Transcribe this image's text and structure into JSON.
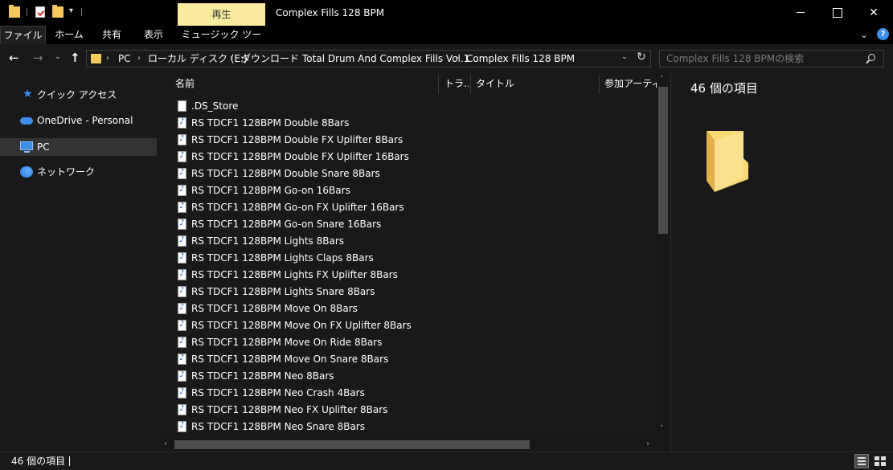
{
  "window": {
    "title": "Complex Fills 128 BPM",
    "contextual_tab": "再生",
    "controls": {
      "minimize": "",
      "maximize": "",
      "close": "✕"
    }
  },
  "quick_access": {
    "dropdown": "▾"
  },
  "ribbon": {
    "tabs": [
      "ファイル",
      "ホーム",
      "共有",
      "表示",
      "ミュージック ツール"
    ],
    "collapse_caret": "⌄",
    "help": "?"
  },
  "nav_buttons": {
    "back": "←",
    "forward": "→",
    "recent": "⌄",
    "up": "↑"
  },
  "address": {
    "crumbs": [
      "PC",
      "ローカル ディスク (E:)",
      "ダウンロード",
      "Total Drum And Complex Fills Vol.1",
      "Complex Fills 128 BPM"
    ],
    "separator": "›",
    "dropdown": "⌄",
    "refresh": "↻"
  },
  "search": {
    "placeholder": "Complex Fills 128 BPMの検索"
  },
  "sidebar": {
    "items": [
      {
        "label": "クイック アクセス",
        "icon": "star-icon",
        "selected": false
      },
      {
        "label": "OneDrive - Personal",
        "icon": "cloud-icon",
        "selected": false
      },
      {
        "label": "PC",
        "icon": "pc-icon",
        "selected": true
      },
      {
        "label": "ネットワーク",
        "icon": "network-icon",
        "selected": false
      }
    ]
  },
  "file_list": {
    "sort_indicator": "˄",
    "columns": [
      "名前",
      "トラ...",
      "タイトル",
      "参加アーティスト"
    ],
    "files": [
      {
        "name": ".DS_Store",
        "icon": "blank-file-icon"
      },
      {
        "name": "RS TDCF1 128BPM Double 8Bars",
        "icon": "audio-file-icon"
      },
      {
        "name": "RS TDCF1 128BPM Double FX Uplifter 8Bars",
        "icon": "audio-file-icon"
      },
      {
        "name": "RS TDCF1 128BPM Double FX Uplifter 16Bars",
        "icon": "audio-file-icon"
      },
      {
        "name": "RS TDCF1 128BPM Double Snare 8Bars",
        "icon": "audio-file-icon"
      },
      {
        "name": "RS TDCF1 128BPM Go-on 16Bars",
        "icon": "audio-file-icon"
      },
      {
        "name": "RS TDCF1 128BPM Go-on FX Uplifter 16Bars",
        "icon": "audio-file-icon"
      },
      {
        "name": "RS TDCF1 128BPM Go-on Snare 16Bars",
        "icon": "audio-file-icon"
      },
      {
        "name": "RS TDCF1 128BPM Lights 8Bars",
        "icon": "audio-file-icon"
      },
      {
        "name": "RS TDCF1 128BPM Lights Claps 8Bars",
        "icon": "audio-file-icon"
      },
      {
        "name": "RS TDCF1 128BPM Lights FX Uplifter 8Bars",
        "icon": "audio-file-icon"
      },
      {
        "name": "RS TDCF1 128BPM Lights Snare 8Bars",
        "icon": "audio-file-icon"
      },
      {
        "name": "RS TDCF1 128BPM Move On 8Bars",
        "icon": "audio-file-icon"
      },
      {
        "name": "RS TDCF1 128BPM Move On FX Uplifter 8Bars",
        "icon": "audio-file-icon"
      },
      {
        "name": "RS TDCF1 128BPM Move On Ride 8Bars",
        "icon": "audio-file-icon"
      },
      {
        "name": "RS TDCF1 128BPM Move On Snare 8Bars",
        "icon": "audio-file-icon"
      },
      {
        "name": "RS TDCF1 128BPM Neo 8Bars",
        "icon": "audio-file-icon"
      },
      {
        "name": "RS TDCF1 128BPM Neo Crash 4Bars",
        "icon": "audio-file-icon"
      },
      {
        "name": "RS TDCF1 128BPM Neo FX Uplifter 8Bars",
        "icon": "audio-file-icon"
      },
      {
        "name": "RS TDCF1 128BPM Neo Snare 8Bars",
        "icon": "audio-file-icon"
      }
    ]
  },
  "scrollbars": {
    "up": "˄",
    "down": "˅",
    "left": "‹",
    "right": "›"
  },
  "details_pane": {
    "item_count": "46 個の項目"
  },
  "status_bar": {
    "item_count": "46 個の項目"
  },
  "colors": {
    "background": "#191919",
    "titlebar": "#000000",
    "contextual_tab": "#f9ec9f",
    "accent": "#3b8eea",
    "folder": "#f4c95d"
  }
}
